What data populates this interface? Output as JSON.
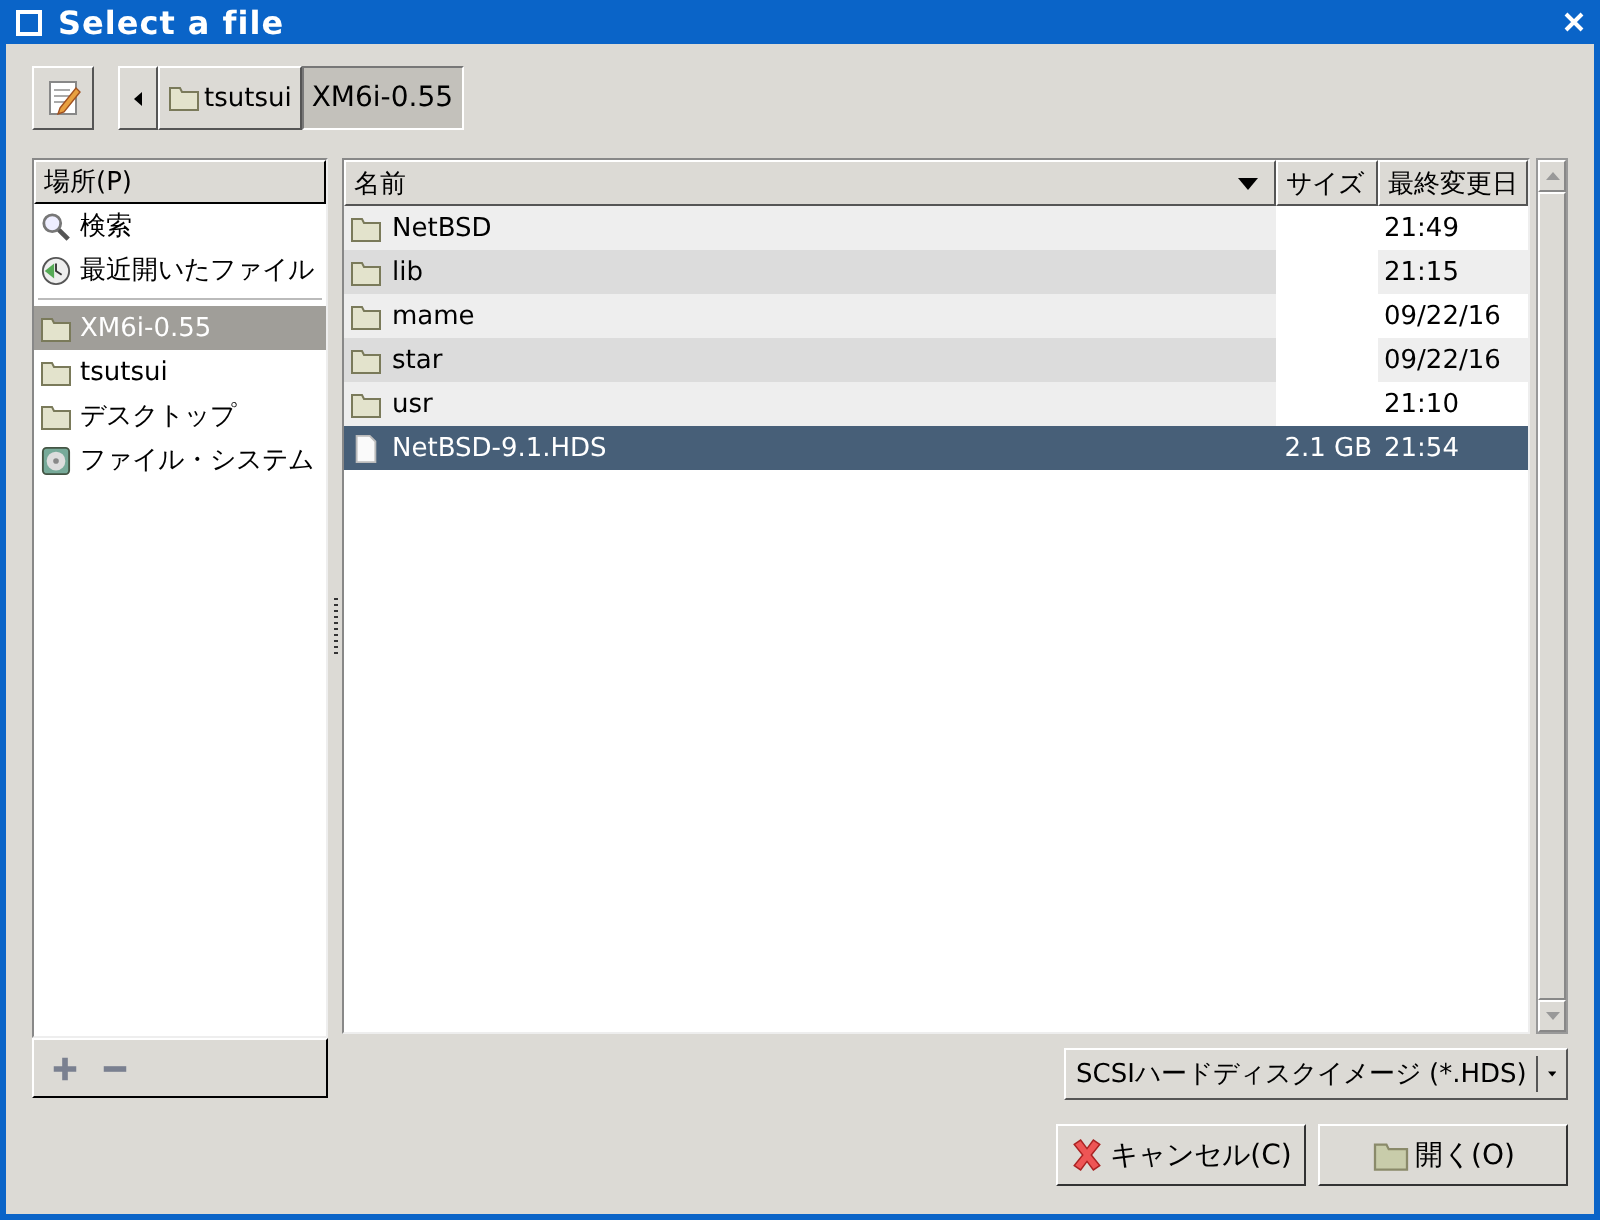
{
  "window": {
    "title": "Select a file"
  },
  "path_bar": {
    "buttons": [
      {
        "label": "tsutsui",
        "selected": false
      },
      {
        "label": "XM6i-0.55",
        "selected": true
      }
    ]
  },
  "places": {
    "header": "場所(P)",
    "system": [
      {
        "kind": "search",
        "label": "検索",
        "selected": false
      },
      {
        "kind": "recent",
        "label": "最近開いたファイル",
        "selected": false
      }
    ],
    "bookmarks": [
      {
        "kind": "folder",
        "label": "XM6i-0.55",
        "selected": true
      },
      {
        "kind": "folder",
        "label": "tsutsui",
        "selected": false
      },
      {
        "kind": "folder",
        "label": "デスクトップ",
        "selected": false
      },
      {
        "kind": "filesystem",
        "label": "ファイル・システム",
        "selected": false
      }
    ]
  },
  "files": {
    "columns": [
      "名前",
      "サイズ",
      "最終変更日"
    ],
    "rows": [
      {
        "kind": "folder",
        "name": "NetBSD",
        "date": "21:49",
        "selected": false
      },
      {
        "kind": "folder",
        "name": "lib",
        "date": "21:15",
        "selected": false
      },
      {
        "kind": "folder",
        "name": "mame",
        "date": "09/22/16",
        "selected": false
      },
      {
        "kind": "folder",
        "name": "star",
        "date": "09/22/16",
        "selected": false
      },
      {
        "kind": "folder",
        "name": "usr",
        "date": "21:10",
        "selected": false
      },
      {
        "kind": "file",
        "name": "NetBSD-9.1.HDS",
        "size": "2.1 GB",
        "date": "21:54",
        "selected": true
      }
    ]
  },
  "filter": {
    "value": "SCSIハードディスクイメージ (*.HDS)"
  },
  "buttons": [
    {
      "kind": "cancel",
      "label": "キャンセル(C)"
    },
    {
      "kind": "open",
      "label": "開く(O)"
    }
  ]
}
